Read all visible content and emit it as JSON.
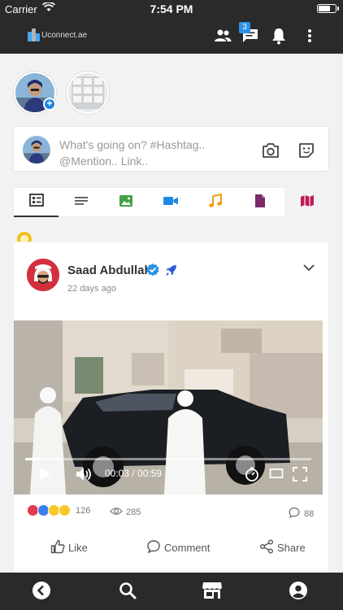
{
  "status_bar": {
    "carrier": "Carrier",
    "time": "7:54 PM"
  },
  "header": {
    "logo_text": "Uconnect.ae",
    "chat_badge": "3"
  },
  "composer": {
    "placeholder": "What's going on? #Hashtag.. @Mention.. Link.."
  },
  "post": {
    "author": "Saad Abdullah",
    "time": "22 days ago",
    "video": {
      "time_display": "00:03 / 00:59",
      "progress": 0.05
    },
    "reaction_count": "126",
    "views": "285",
    "comments": "88",
    "actions": {
      "like": "Like",
      "comment": "Comment",
      "share": "Share"
    }
  },
  "colors": {
    "bar_bg": "#2a2a2a",
    "accent_blue": "#1e88e5",
    "tab_image": "#43a047",
    "tab_video": "#1e88e5",
    "tab_audio": "#f39c12",
    "tab_file": "#7b2a6b",
    "tab_map": "#c2185b"
  },
  "icons": {
    "header": [
      "people-icon",
      "chat-icon",
      "bell-icon",
      "more-vertical-icon"
    ],
    "tabs": [
      "feed-icon",
      "text-icon",
      "image-icon",
      "video-icon",
      "music-icon",
      "file-icon",
      "map-icon"
    ],
    "bottom_nav": [
      "back-icon",
      "search-icon",
      "store-icon",
      "profile-icon"
    ]
  }
}
